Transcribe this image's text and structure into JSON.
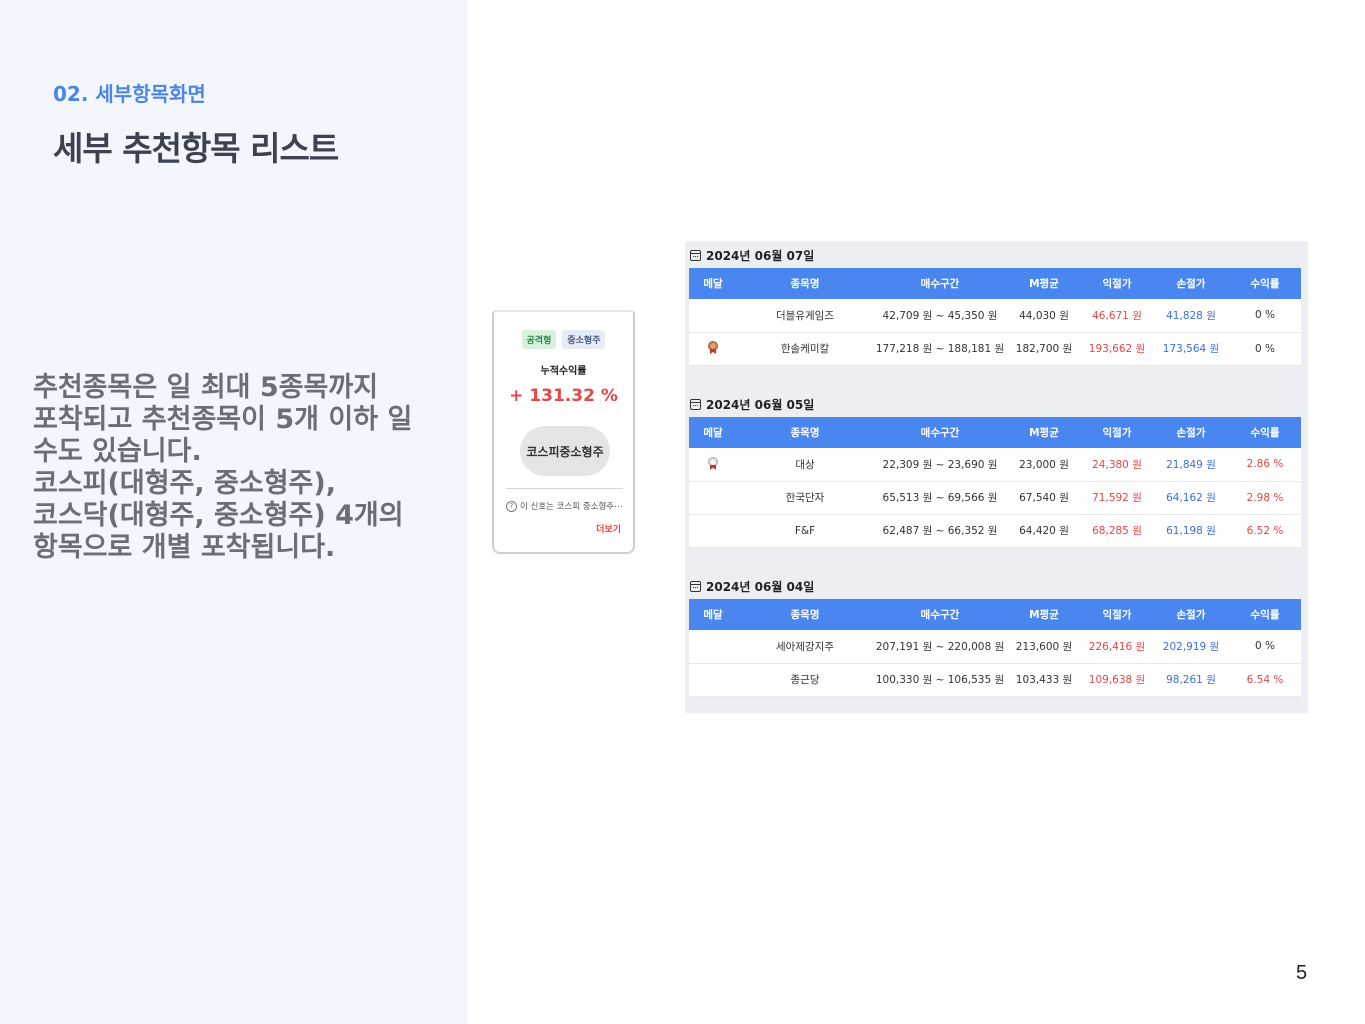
{
  "slide": {
    "section_label": "02. 세부항목화면",
    "title": "세부 추천항목 리스트",
    "description_lines": [
      "추천종목은 일 최대 5종목까지",
      "포착되고 추천종목이 5개 이하 일",
      "수도 있습니다.",
      "코스피(대형주, 중소형주),",
      "코스닥(대형주, 중소형주) 4개의",
      "항목으로 개별 포착됩니다."
    ],
    "page_number": "5"
  },
  "card": {
    "tags": [
      "공격형",
      "중소형주"
    ],
    "label": "누적수익률",
    "value": "+ 131.32 %",
    "pill": "코스피중소형주",
    "info_icon": "?",
    "info_text": "이 신호는 코스피 중소형주⋯",
    "more": "더보기",
    "colors": {
      "positive": "#e84545",
      "tag_green": "#d9f2e0"
    }
  },
  "table_headers": [
    "메달",
    "종목명",
    "매수구간",
    "M평균",
    "익절가",
    "손절가",
    "수익률"
  ],
  "days": [
    {
      "date": "2024년 06월 07일",
      "rows": [
        {
          "medal": "",
          "name": "더블유게임즈",
          "range": "42,709 원 ~ 45,350 원",
          "avg": "44,030 원",
          "take": "46,671 원",
          "stop": "41,828 원",
          "rate": "0 %"
        },
        {
          "medal": "bronze",
          "name": "한솔케미칼",
          "range": "177,218 원 ~ 188,181 원",
          "avg": "182,700 원",
          "take": "193,662 원",
          "stop": "173,564 원",
          "rate": "0 %"
        }
      ]
    },
    {
      "date": "2024년 06월 05일",
      "rows": [
        {
          "medal": "silver",
          "name": "대상",
          "range": "22,309 원 ~ 23,690 원",
          "avg": "23,000 원",
          "take": "24,380 원",
          "stop": "21,849 원",
          "rate": "2.86 %"
        },
        {
          "medal": "",
          "name": "한국단자",
          "range": "65,513 원 ~ 69,566 원",
          "avg": "67,540 원",
          "take": "71,592 원",
          "stop": "64,162 원",
          "rate": "2.98 %"
        },
        {
          "medal": "",
          "name": "F&F",
          "range": "62,487 원 ~ 66,352 원",
          "avg": "64,420 원",
          "take": "68,285 원",
          "stop": "61,198 원",
          "rate": "6.52 %"
        }
      ]
    },
    {
      "date": "2024년 06월 04일",
      "rows": [
        {
          "medal": "",
          "name": "세아제강지주",
          "range": "207,191 원 ~ 220,008 원",
          "avg": "213,600 원",
          "take": "226,416 원",
          "stop": "202,919 원",
          "rate": "0 %"
        },
        {
          "medal": "",
          "name": "종근당",
          "range": "100,330 원 ~ 106,535 원",
          "avg": "103,433 원",
          "take": "109,638 원",
          "stop": "98,261 원",
          "rate": "6.54 %"
        }
      ]
    }
  ],
  "colors": {
    "header_bg": "#4a86f0",
    "take_profit": "#e84545",
    "stop_loss": "#3b6ee0",
    "left_panel": "#f3f6fd"
  }
}
